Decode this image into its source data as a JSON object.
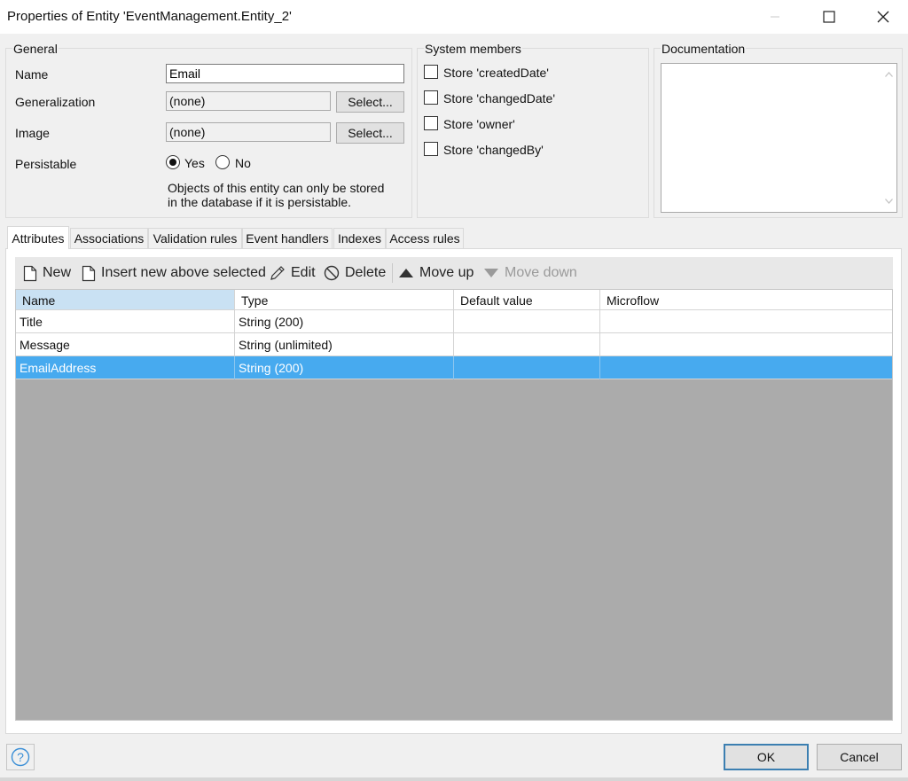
{
  "window": {
    "title": "Properties of Entity 'EventManagement.Entity_2'"
  },
  "general": {
    "legend": "General",
    "name_label": "Name",
    "name_value": "Email",
    "generalization_label": "Generalization",
    "generalization_value": "(none)",
    "generalization_button": "Select...",
    "image_label": "Image",
    "image_value": "(none)",
    "image_button": "Select...",
    "persistable_label": "Persistable",
    "persistable_yes": "Yes",
    "persistable_no": "No",
    "persistable_selected": "Yes",
    "note_line1": "Objects of this entity can only be stored",
    "note_line2": "in the database if it is persistable."
  },
  "system_members": {
    "legend": "System members",
    "items": [
      {
        "label": "Store 'createdDate'",
        "checked": false
      },
      {
        "label": "Store 'changedDate'",
        "checked": false
      },
      {
        "label": "Store 'owner'",
        "checked": false
      },
      {
        "label": "Store 'changedBy'",
        "checked": false
      }
    ]
  },
  "documentation": {
    "legend": "Documentation",
    "value": ""
  },
  "tabs": [
    {
      "label": "Attributes",
      "active": true
    },
    {
      "label": "Associations",
      "active": false
    },
    {
      "label": "Validation rules",
      "active": false
    },
    {
      "label": "Event handlers",
      "active": false
    },
    {
      "label": "Indexes",
      "active": false
    },
    {
      "label": "Access rules",
      "active": false
    }
  ],
  "toolbar": {
    "new": "New",
    "insert": "Insert new above selected",
    "edit": "Edit",
    "delete": "Delete",
    "move_up": "Move up",
    "move_down": "Move down"
  },
  "grid": {
    "columns": [
      "Name",
      "Type",
      "Default value",
      "Microflow"
    ],
    "rows": [
      {
        "name": "Title",
        "type": "String (200)",
        "default": "",
        "microflow": ""
      },
      {
        "name": "Message",
        "type": "String (unlimited)",
        "default": "",
        "microflow": ""
      },
      {
        "name": "EmailAddress",
        "type": "String (200)",
        "default": "",
        "microflow": "",
        "selected": true
      }
    ]
  },
  "footer": {
    "ok": "OK",
    "cancel": "Cancel"
  },
  "colors": {
    "selection": "#47aaef",
    "header_selected": "#c9e1f3",
    "grid_empty": "#ababab"
  }
}
